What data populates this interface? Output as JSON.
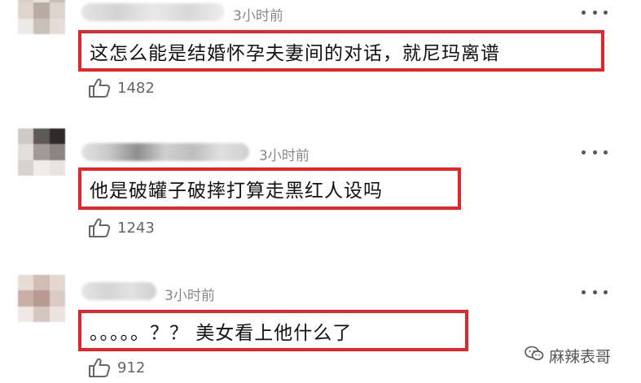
{
  "comments": [
    {
      "time": "3小时前",
      "text": "这怎么能是结婚怀孕夫妻间的对话，就尼玛离谱",
      "likes": "1482"
    },
    {
      "time": "3小时前",
      "text": "他是破罐子破摔打算走黑红人设吗",
      "likes": "1243"
    },
    {
      "time": "3小时前",
      "text": "。。。。。？？ 美女看上他什么了",
      "likes": "912"
    }
  ],
  "watermark": {
    "text": "麻辣表哥",
    "icon": "wechat-icon"
  },
  "icons": {
    "like": "thumbs-up-icon",
    "more": "more-options-icon"
  },
  "colors": {
    "highlight_border": "#e8232a",
    "time_text": "#888888",
    "like_text": "#666666"
  }
}
